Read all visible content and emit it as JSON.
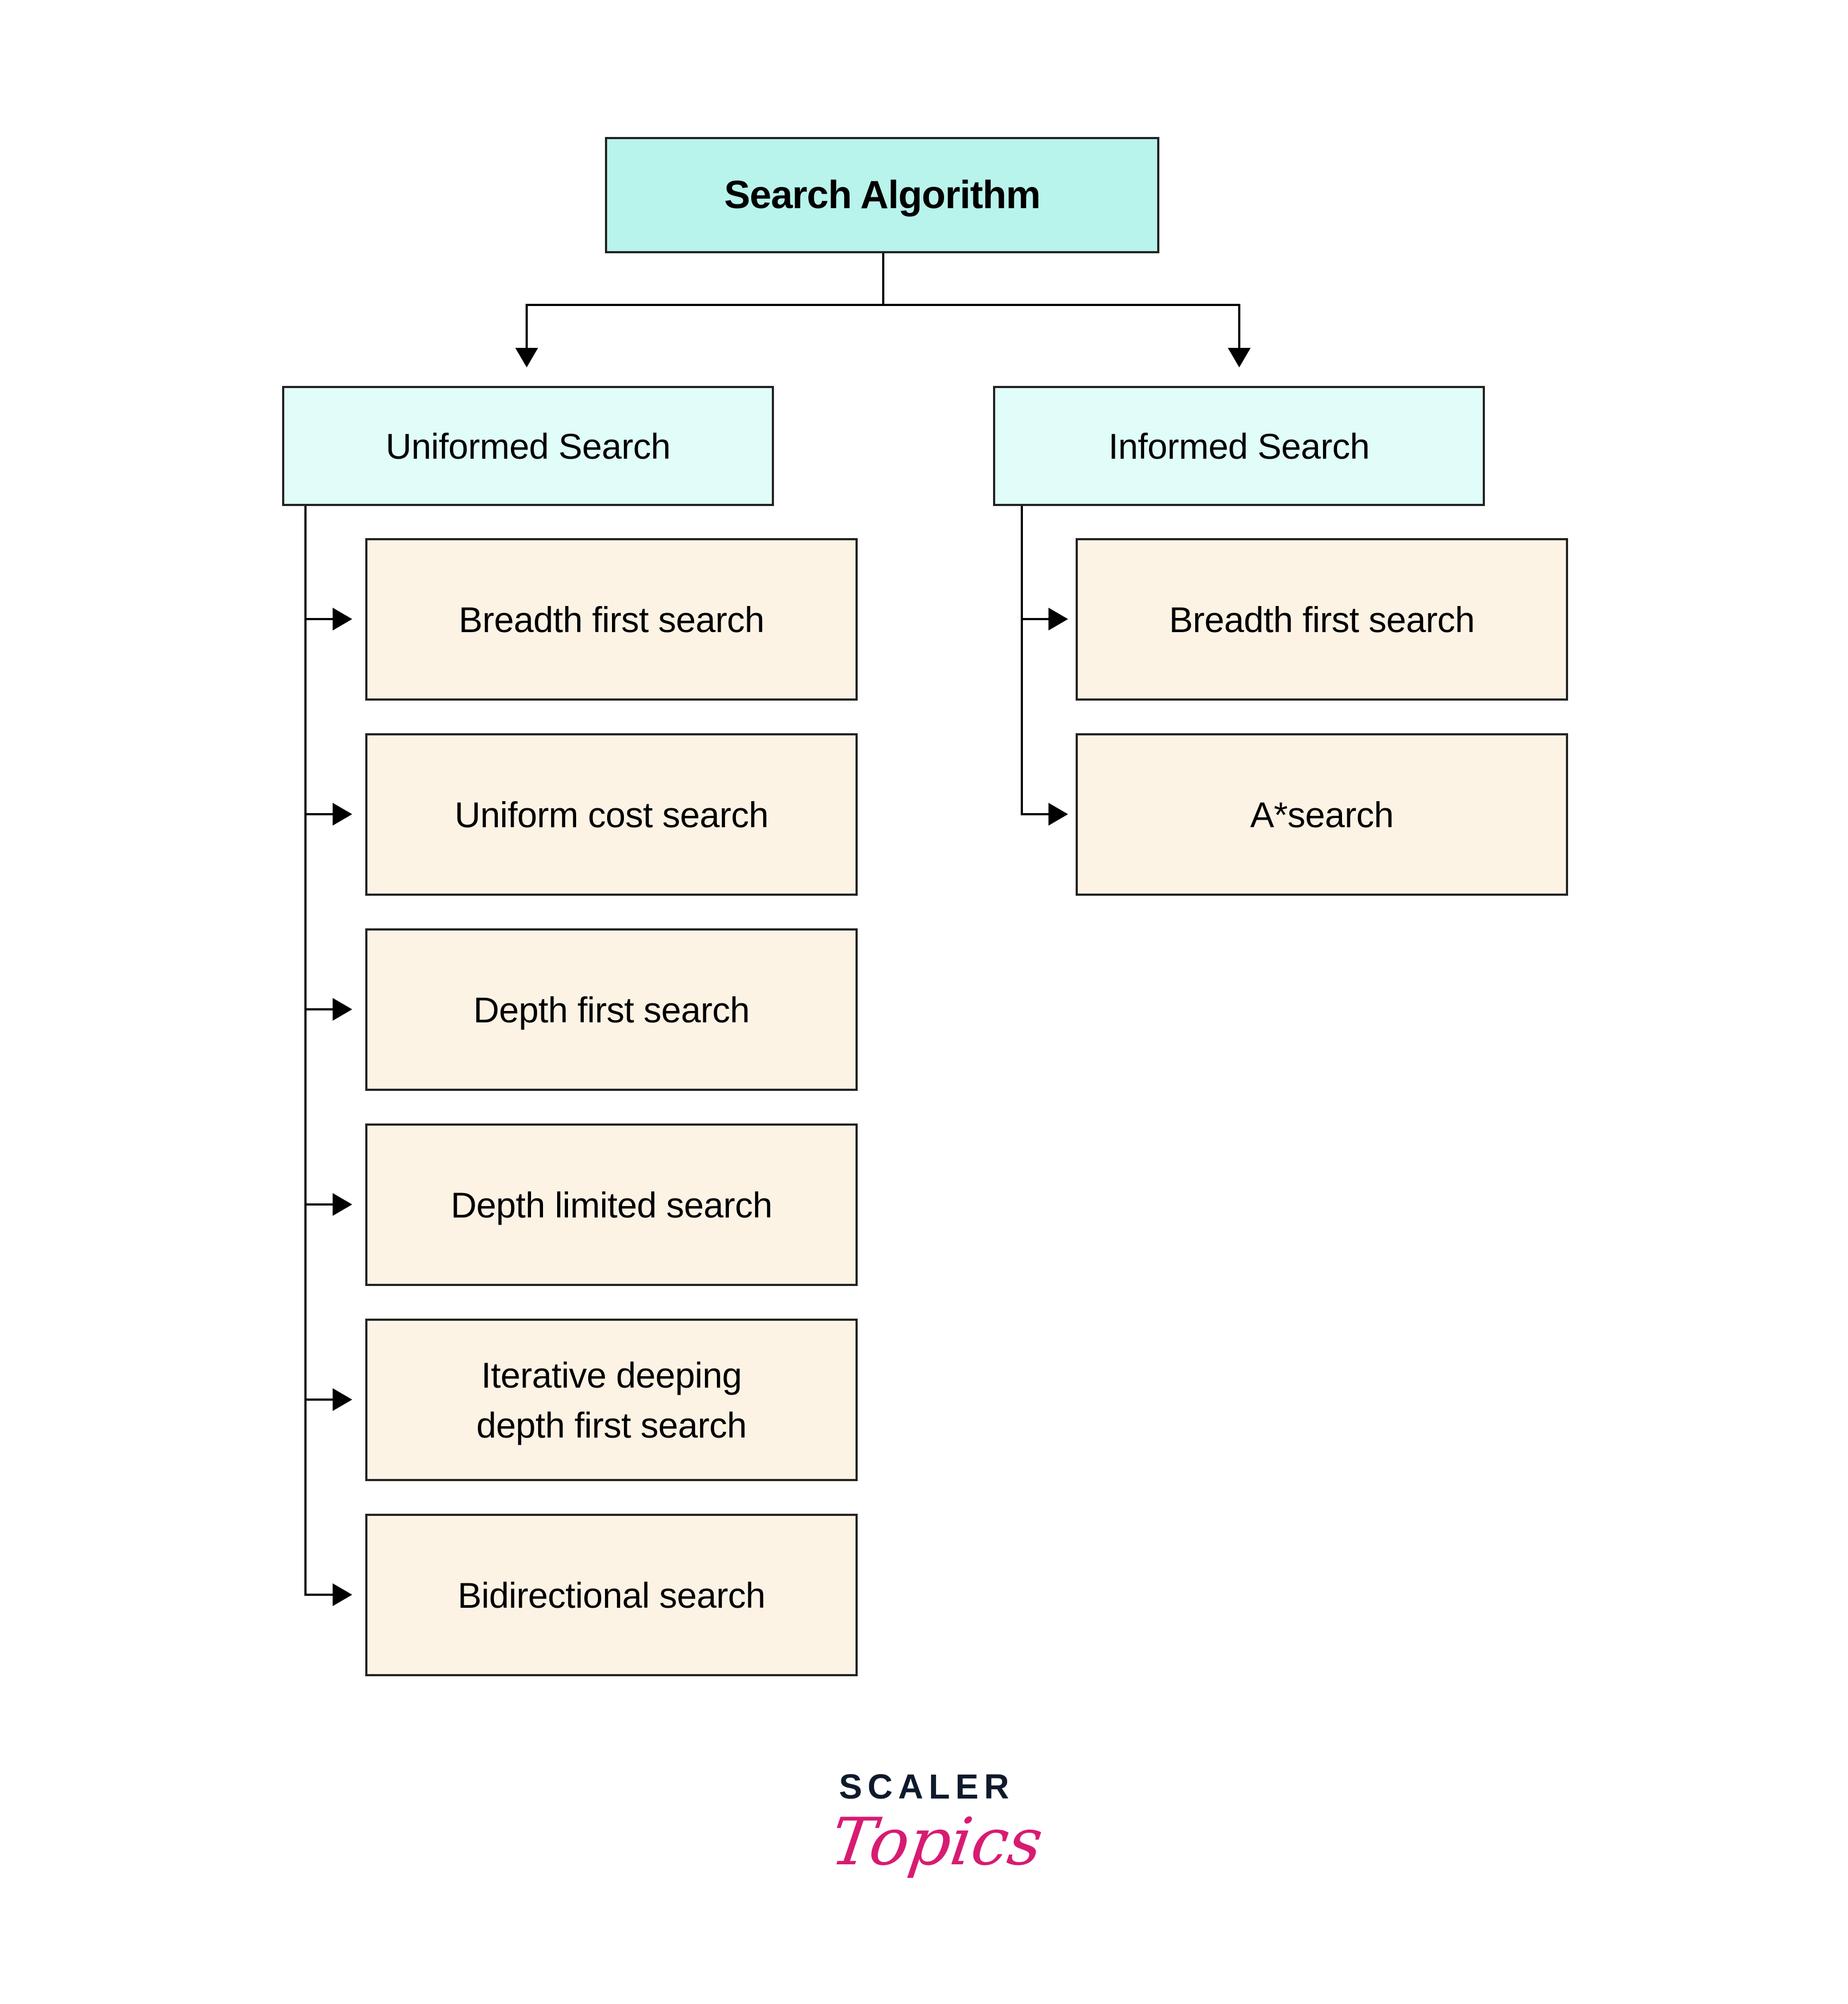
{
  "diagram": {
    "root": {
      "label": "Search Algorithm"
    },
    "categories": [
      {
        "label": "Uniformed Search",
        "children": [
          "Breadth first search",
          "Uniform cost search",
          "Depth first search",
          "Depth limited search",
          "Iterative deeping depth first search",
          "Bidirectional search"
        ]
      },
      {
        "label": "Informed Search",
        "children": [
          "Breadth first search",
          "A*search"
        ]
      }
    ],
    "colors": {
      "root_fill": "#b8f3ec",
      "category_fill": "#e1fdf9",
      "leaf_fill": "#fdf3e5",
      "stroke": "#000000"
    }
  },
  "branding": {
    "line1": "SCALER",
    "line2": "Topics",
    "line1_color": "#0e1a2c",
    "line2_color": "#d81b72"
  }
}
